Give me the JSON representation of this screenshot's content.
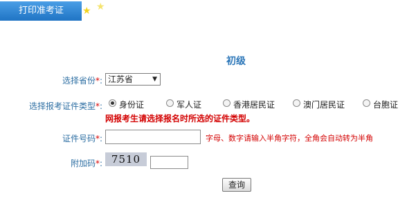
{
  "tab": {
    "label": "打印准考证"
  },
  "level": "初级",
  "form": {
    "province": {
      "label": "选择省份",
      "required_mark": "*",
      "colon": ":",
      "value": "江苏省"
    },
    "id_type": {
      "label": "选择报考证件类型",
      "required_mark": "*",
      "colon": ":",
      "options": [
        "身份证",
        "军人证",
        "香港居民证",
        "澳门居民证",
        "台胞证"
      ],
      "selected": "身份证",
      "warning": "网报考生请选择报名时所选的证件类型。"
    },
    "id_number": {
      "label": "证件号码",
      "required_mark": "*",
      "colon": ":",
      "value": "",
      "hint": "字母、数字请输入半角字符，全角会自动转为半角"
    },
    "captcha": {
      "label": "附加码",
      "required_mark": "*",
      "colon": ":",
      "image_text": "7510",
      "value": ""
    }
  },
  "submit_label": "查询",
  "colors": {
    "tab_bg": "#2b82d6",
    "label": "#2e6fa3",
    "required": "#d80000",
    "warning": "#d30000",
    "level_title": "#2b76b8"
  },
  "icons": [
    "star-icon",
    "star-icon"
  ]
}
